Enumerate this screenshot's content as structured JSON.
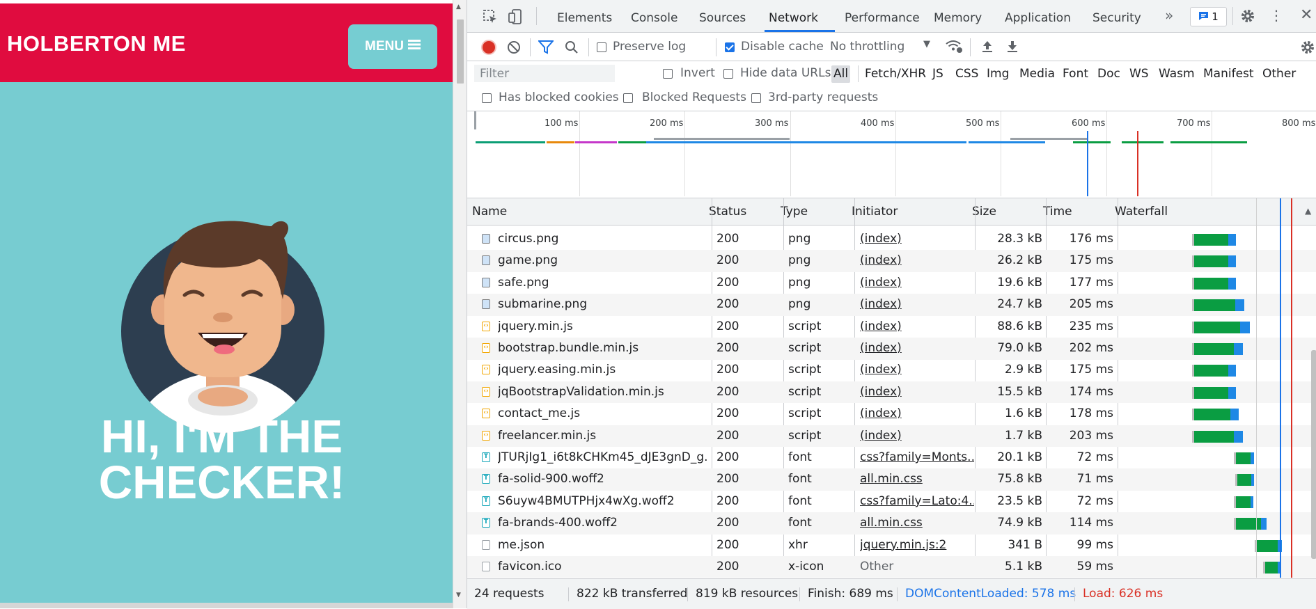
{
  "site": {
    "brand": "HOLBERTON ME",
    "menu_label": "MENU",
    "hero_line1": "HI, I'M THE",
    "hero_line2": "CHECKER!",
    "colors": {
      "nav": "#e00c3f",
      "hero": "#77ccd1",
      "menu_button": "#76cdd2"
    }
  },
  "devtools": {
    "tabs": [
      "Elements",
      "Console",
      "Sources",
      "Network",
      "Performance",
      "Memory",
      "Application",
      "Security"
    ],
    "active_tab": "Network",
    "issues_count": "1",
    "toolbar": {
      "preserve_log": "Preserve log",
      "disable_cache": "Disable cache",
      "throttling": "No throttling"
    },
    "filter": {
      "placeholder": "Filter",
      "invert": "Invert",
      "hide_data_urls": "Hide data URLs",
      "types": [
        "All",
        "Fetch/XHR",
        "JS",
        "CSS",
        "Img",
        "Media",
        "Font",
        "Doc",
        "WS",
        "Wasm",
        "Manifest",
        "Other"
      ],
      "has_blocked_cookies": "Has blocked cookies",
      "blocked_requests": "Blocked Requests",
      "third_party": "3rd-party requests"
    },
    "overview_ticks": [
      "100 ms",
      "200 ms",
      "300 ms",
      "400 ms",
      "500 ms",
      "600 ms",
      "700 ms",
      "800 ms"
    ],
    "columns": {
      "name": "Name",
      "status": "Status",
      "type": "Type",
      "initiator": "Initiator",
      "size": "Size",
      "time": "Time",
      "waterfall": "Waterfall"
    },
    "requests": [
      {
        "name": "circus.png",
        "status": "200",
        "type": "png",
        "initiator": "(index)",
        "size": "28.3 kB",
        "time": "176 ms",
        "kind": "img"
      },
      {
        "name": "game.png",
        "status": "200",
        "type": "png",
        "initiator": "(index)",
        "size": "26.2 kB",
        "time": "175 ms",
        "kind": "img"
      },
      {
        "name": "safe.png",
        "status": "200",
        "type": "png",
        "initiator": "(index)",
        "size": "19.6 kB",
        "time": "177 ms",
        "kind": "img"
      },
      {
        "name": "submarine.png",
        "status": "200",
        "type": "png",
        "initiator": "(index)",
        "size": "24.7 kB",
        "time": "205 ms",
        "kind": "img"
      },
      {
        "name": "jquery.min.js",
        "status": "200",
        "type": "script",
        "initiator": "(index)",
        "size": "88.6 kB",
        "time": "235 ms",
        "kind": "script"
      },
      {
        "name": "bootstrap.bundle.min.js",
        "status": "200",
        "type": "script",
        "initiator": "(index)",
        "size": "79.0 kB",
        "time": "202 ms",
        "kind": "script"
      },
      {
        "name": "jquery.easing.min.js",
        "status": "200",
        "type": "script",
        "initiator": "(index)",
        "size": "2.9 kB",
        "time": "175 ms",
        "kind": "script"
      },
      {
        "name": "jqBootstrapValidation.min.js",
        "status": "200",
        "type": "script",
        "initiator": "(index)",
        "size": "15.5 kB",
        "time": "174 ms",
        "kind": "script"
      },
      {
        "name": "contact_me.js",
        "status": "200",
        "type": "script",
        "initiator": "(index)",
        "size": "1.6 kB",
        "time": "178 ms",
        "kind": "script"
      },
      {
        "name": "freelancer.min.js",
        "status": "200",
        "type": "script",
        "initiator": "(index)",
        "size": "1.7 kB",
        "time": "203 ms",
        "kind": "script"
      },
      {
        "name": "JTURjIg1_i6t8kCHKm45_dJE3gnD_g....",
        "status": "200",
        "type": "font",
        "initiator": "css?family=Monts...",
        "size": "20.1 kB",
        "time": "72 ms",
        "kind": "font"
      },
      {
        "name": "fa-solid-900.woff2",
        "status": "200",
        "type": "font",
        "initiator": "all.min.css",
        "size": "75.8 kB",
        "time": "71 ms",
        "kind": "font"
      },
      {
        "name": "S6uyw4BMUTPHjx4wXg.woff2",
        "status": "200",
        "type": "font",
        "initiator": "css?family=Lato:4...",
        "size": "23.5 kB",
        "time": "72 ms",
        "kind": "font"
      },
      {
        "name": "fa-brands-400.woff2",
        "status": "200",
        "type": "font",
        "initiator": "all.min.css",
        "size": "74.9 kB",
        "time": "114 ms",
        "kind": "font"
      },
      {
        "name": "me.json",
        "status": "200",
        "type": "xhr",
        "initiator": "jquery.min.js:2",
        "size": "341 B",
        "time": "99 ms",
        "kind": "doc"
      },
      {
        "name": "favicon.ico",
        "status": "200",
        "type": "x-icon",
        "initiator": "Other",
        "size": "5.1 kB",
        "time": "59 ms",
        "kind": "doc"
      }
    ],
    "status": {
      "requests": "24 requests",
      "transferred": "822 kB transferred",
      "resources": "819 kB resources",
      "finish": "Finish: 689 ms",
      "dom_content_loaded": "DOMContentLoaded: 578 ms",
      "load": "Load: 626 ms"
    },
    "colors": {
      "accent": "#1a73e8",
      "dcl": "#1a73e8",
      "load": "#d93025",
      "waiting": "#0a9d42",
      "download": "#1e88e5"
    }
  }
}
